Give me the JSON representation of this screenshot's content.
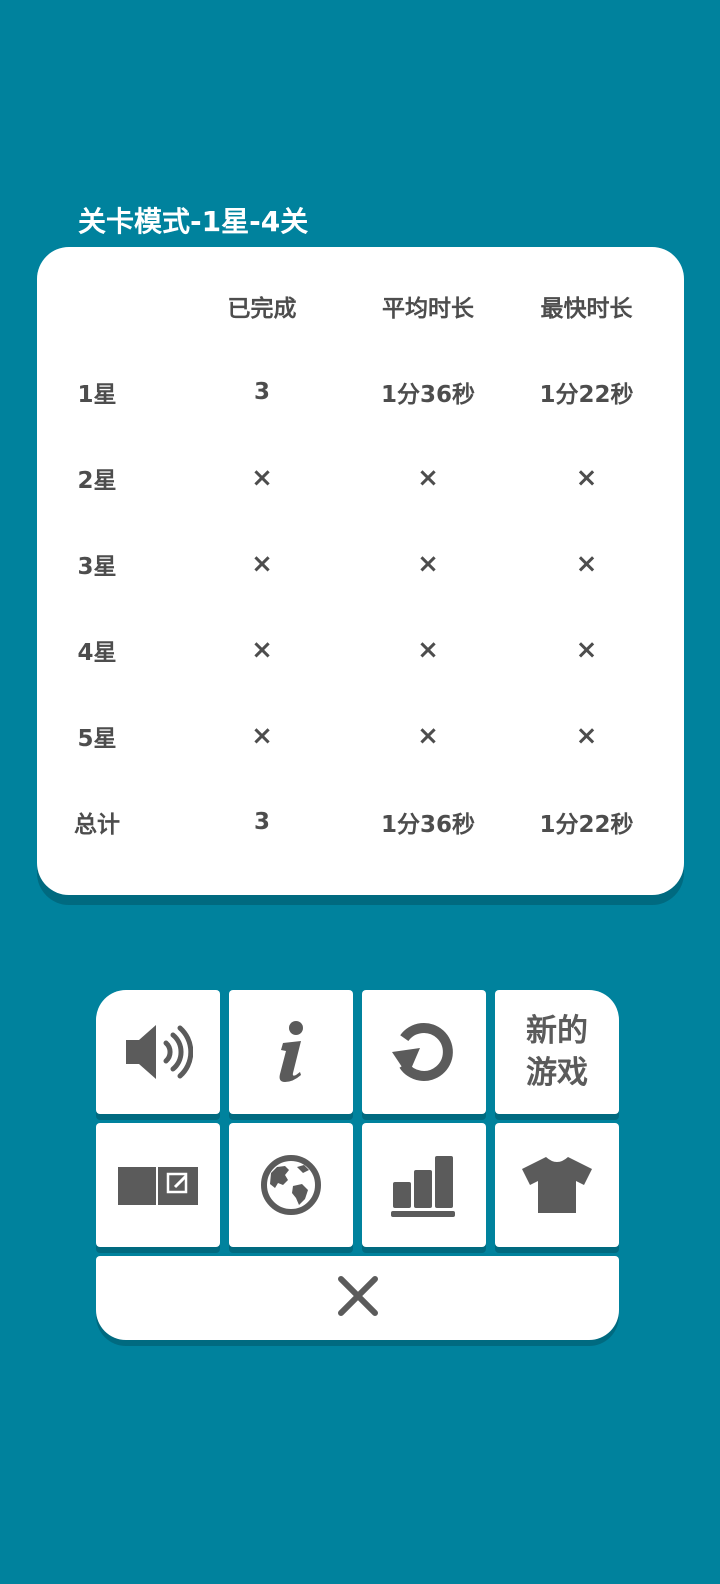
{
  "title": "关卡模式-1星-4关",
  "stats": {
    "headers": [
      "",
      "已完成",
      "平均时长",
      "最快时长"
    ],
    "rows": [
      [
        "1星",
        "3",
        "1分36秒",
        "1分22秒"
      ],
      [
        "2星",
        "×",
        "×",
        "×"
      ],
      [
        "3星",
        "×",
        "×",
        "×"
      ],
      [
        "4星",
        "×",
        "×",
        "×"
      ],
      [
        "5星",
        "×",
        "×",
        "×"
      ],
      [
        "总计",
        "3",
        "1分36秒",
        "1分22秒"
      ]
    ]
  },
  "menu": {
    "new_game_label": "新的游戏",
    "icons": {
      "sound": "speaker-volume-icon",
      "info": "info-icon",
      "restart": "restart-icon",
      "notes": "notebook-edit-icon",
      "language": "globe-icon",
      "stats": "bar-chart-icon",
      "theme": "t-shirt-icon",
      "close": "close-icon"
    }
  },
  "colors": {
    "background": "#00829D",
    "card": "#FFFFFF",
    "text": "#4D4D4D",
    "icon": "#5B5B5B"
  }
}
